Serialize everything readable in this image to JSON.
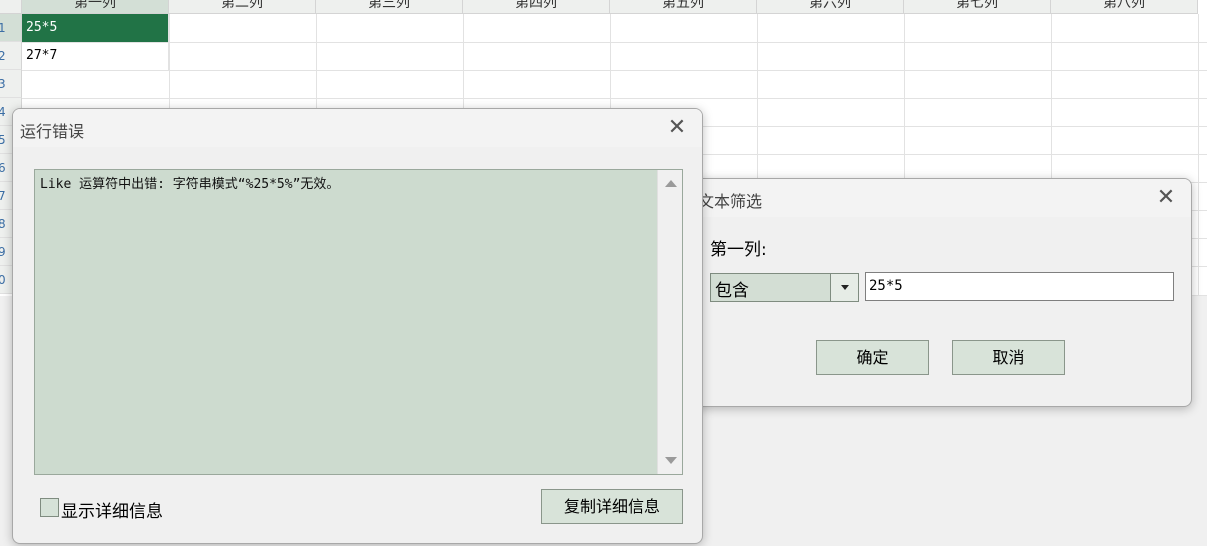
{
  "sheet": {
    "columns": [
      "第一列",
      "第二列",
      "第三列",
      "第四列",
      "第五列",
      "第六列",
      "第七列",
      "第八列"
    ],
    "row_numbers": [
      "1",
      "2",
      "3",
      "4",
      "5",
      "6",
      "7",
      "8",
      "9",
      "0"
    ],
    "cells": {
      "r1c1": "25*5",
      "r2c1": "27*7"
    },
    "active_cell_color": "#217346"
  },
  "error_dialog": {
    "title": "运行错误",
    "close_icon": "close-icon",
    "message": "Like 运算符中出错: 字符串模式“%25*5%”无效。",
    "show_details_label": "显示详细信息",
    "copy_details_label": "复制详细信息",
    "message_bg": "#cddbcf"
  },
  "filter_dialog": {
    "title": "文本筛选",
    "close_icon": "close-icon",
    "field_label": "第一列:",
    "operator": "包含",
    "value": "25*5",
    "ok_label": "确定",
    "cancel_label": "取消"
  }
}
